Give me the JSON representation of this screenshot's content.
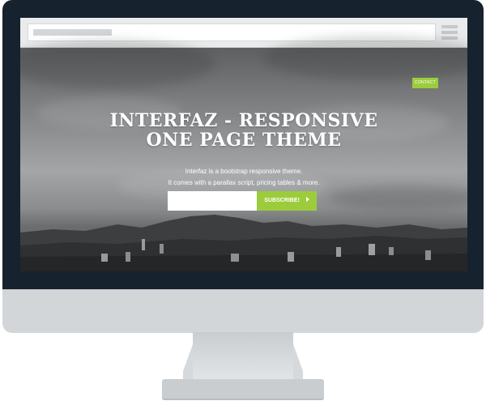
{
  "browser": {
    "url": "",
    "menu_icon": "hamburger-menu-icon"
  },
  "nav": {
    "contact_label": "CONTACT"
  },
  "hero": {
    "title_line1": "INTERFAZ - RESPONSIVE",
    "title_line2": "ONE PAGE THEME",
    "subtitle_line1": "Interfaz is a bootstrap responsive theme.",
    "subtitle_line2": "It comes with a parallax script, pricing tables & more.",
    "email_placeholder": "",
    "subscribe_label": "SUBSCRIBE!",
    "subscribe_icon": "arrow-right-icon"
  },
  "colors": {
    "accent": "#9ccc3c",
    "monitor_bezel": "#16222d",
    "monitor_chin": "#d2d6d9"
  }
}
